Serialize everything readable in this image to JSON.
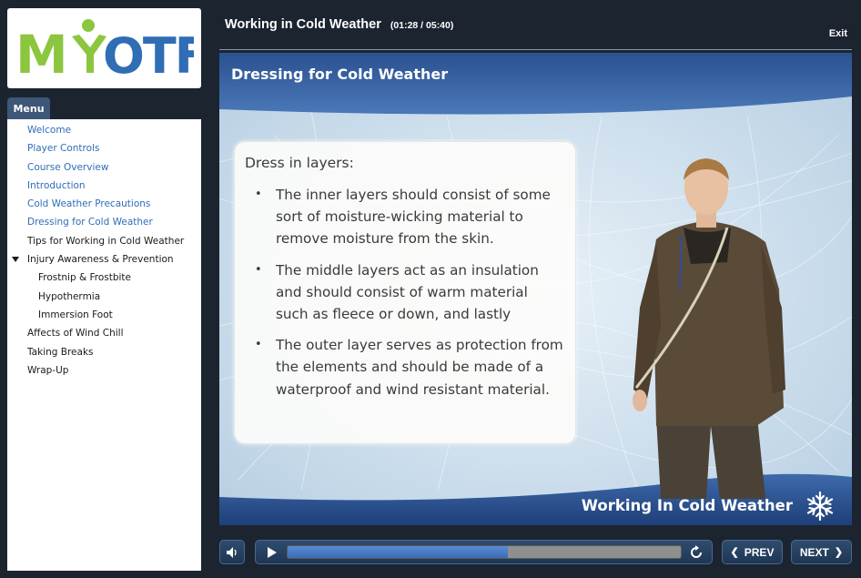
{
  "course": {
    "title": "Working in Cold Weather",
    "time": "(01:28 / 05:40)",
    "exit_label": "Exit"
  },
  "logo": {
    "text": "MYOTF",
    "colors": {
      "green": "#8cc63f",
      "blue": "#2f6db4"
    }
  },
  "menu": {
    "tab_label": "Menu",
    "items": [
      {
        "label": "Welcome",
        "visited": true,
        "level": 0
      },
      {
        "label": "Player Controls",
        "visited": true,
        "level": 0
      },
      {
        "label": "Course Overview",
        "visited": true,
        "level": 0
      },
      {
        "label": "Introduction",
        "visited": true,
        "level": 0
      },
      {
        "label": "Cold Weather Precautions",
        "visited": true,
        "level": 0
      },
      {
        "label": "Dressing for Cold Weather",
        "visited": true,
        "level": 0
      },
      {
        "label": "Tips for Working in Cold Weather",
        "visited": false,
        "level": 0
      },
      {
        "label": "Injury Awareness & Prevention",
        "visited": false,
        "level": 0,
        "expanded": true
      },
      {
        "label": "Frostnip & Frostbite",
        "visited": false,
        "level": 1
      },
      {
        "label": "Hypothermia",
        "visited": false,
        "level": 1
      },
      {
        "label": "Immersion Foot",
        "visited": false,
        "level": 1
      },
      {
        "label": "Affects of Wind Chill",
        "visited": false,
        "level": 0
      },
      {
        "label": "Taking Breaks",
        "visited": false,
        "level": 0
      },
      {
        "label": "Wrap-Up",
        "visited": false,
        "level": 0
      }
    ]
  },
  "slide": {
    "title": "Dressing for Cold Weather",
    "heading": "Dress in layers:",
    "bullets": [
      "The inner layers should consist of some sort of moisture-wicking material to remove moisture from the skin.",
      "The middle layers act as an insulation and should consist of warm material such as fleece or down, and lastly",
      "The outer layer serves as protection from the elements and should be made of a waterproof and wind resistant material."
    ],
    "footer_title": "Working In Cold Weather"
  },
  "player": {
    "progress": 0.56,
    "prev_label": "PREV",
    "next_label": "NEXT",
    "icons": [
      "volume-icon",
      "play-icon",
      "replay-icon",
      "snowflake-icon"
    ]
  },
  "colors": {
    "accent": "#2f6db4",
    "chrome": "#1c2430",
    "button": "#2f4c6e"
  }
}
